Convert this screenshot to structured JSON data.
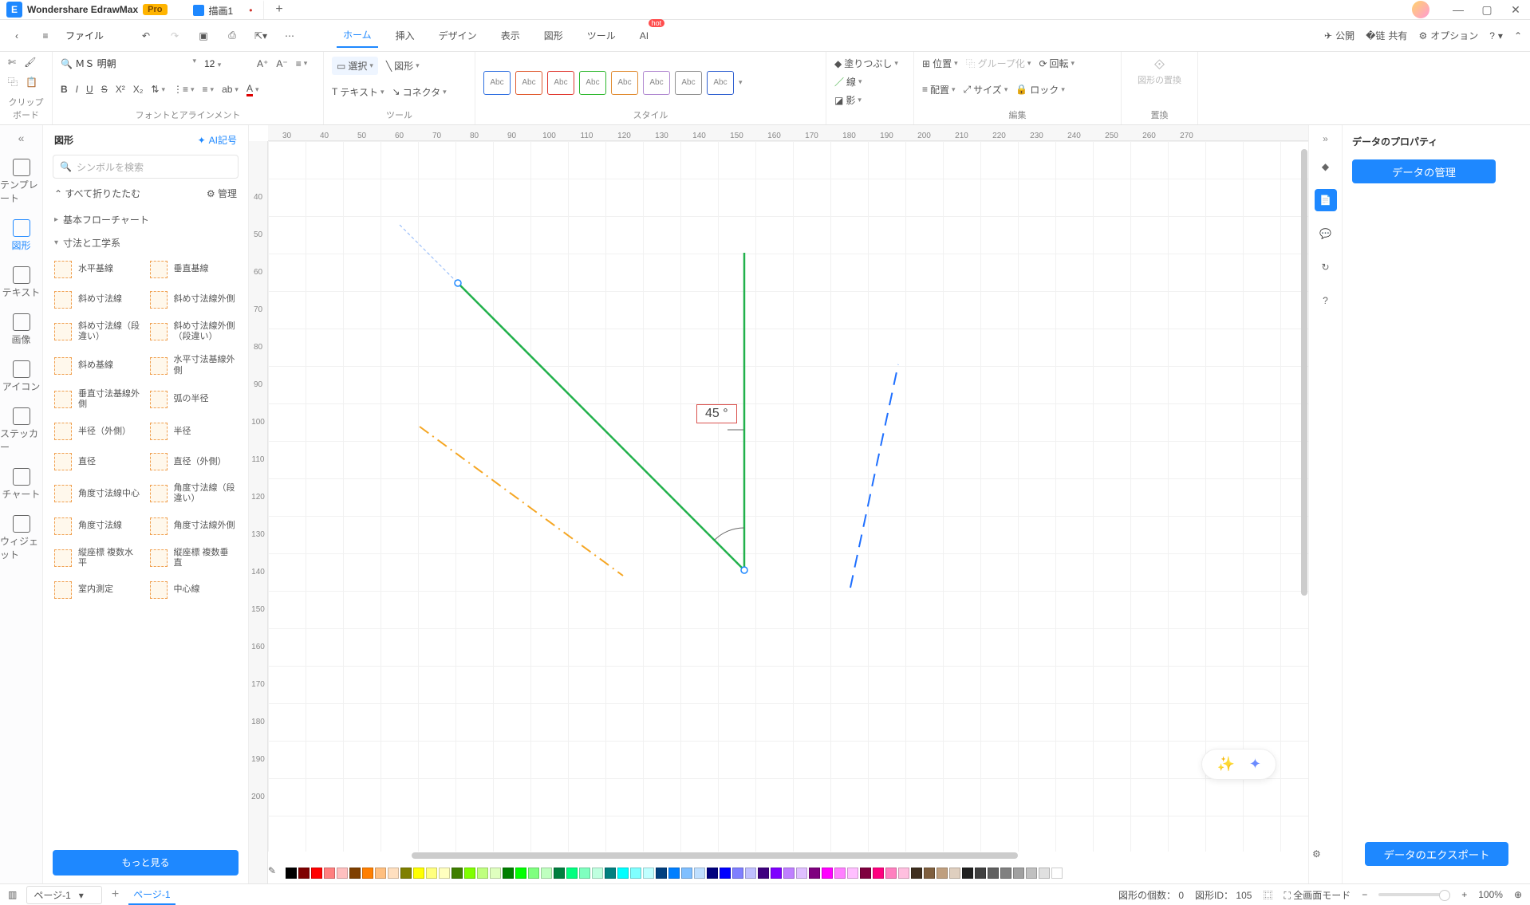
{
  "titlebar": {
    "app_name": "Wondershare EdrawMax",
    "pro": "Pro",
    "tab1": "描画1"
  },
  "menubar": {
    "file": "ファイル",
    "items": [
      "ホーム",
      "挿入",
      "デザイン",
      "表示",
      "図形",
      "ツール",
      "AI"
    ],
    "hot": "hot",
    "publish": "公開",
    "share": "共有",
    "option": "オプション"
  },
  "ribbon": {
    "clipboard_label": "クリップボード",
    "font_label": "フォントとアラインメント",
    "tool_label": "ツール",
    "style_label": "スタイル",
    "edit_label": "編集",
    "replace_label": "置換",
    "font_name": "ＭＳ 明朝",
    "font_size": "12",
    "select": "選択",
    "shape": "図形",
    "text": "テキスト",
    "connector": "コネクタ",
    "fill": "塗りつぶし",
    "line": "線",
    "shadow": "影",
    "position": "位置",
    "group": "グループ化",
    "rotate": "回転",
    "align": "配置",
    "size": "サイズ",
    "lock": "ロック",
    "replace_shape": "図形の置換",
    "abc": "Abc"
  },
  "leftrail": [
    "テンプレート",
    "図形",
    "テキスト",
    "画像",
    "アイコン",
    "ステッカー",
    "チャート",
    "ウィジェット"
  ],
  "shapes": {
    "title": "図形",
    "ai": "AI記号",
    "search_ph": "シンボルを検索",
    "fold_all": "すべて折りたたむ",
    "manage": "管理",
    "cat1": "基本フローチャート",
    "cat2": "寸法と工学系",
    "items": [
      "水平基線",
      "垂直基線",
      "斜め寸法線",
      "斜め寸法線外側",
      "斜め寸法線（段違い）",
      "斜め寸法線外側（段違い）",
      "斜め基線",
      "水平寸法基線外側",
      "垂直寸法基線外側",
      "弧の半径",
      "半径（外側）",
      "半径",
      "直径",
      "直径（外側）",
      "角度寸法線中心",
      "角度寸法線（段違い）",
      "角度寸法線",
      "角度寸法線外側",
      "縦座標 複数水平",
      "縦座標 複数垂直",
      "室内測定",
      "中心線"
    ],
    "more": "もっと見る"
  },
  "ruler_h": [
    "30",
    "40",
    "50",
    "60",
    "70",
    "80",
    "90",
    "100",
    "110",
    "120",
    "130",
    "140",
    "150",
    "160",
    "170",
    "180",
    "190",
    "200",
    "210",
    "220",
    "230",
    "240",
    "250",
    "260",
    "270"
  ],
  "ruler_v": [
    "",
    "40",
    "50",
    "60",
    "70",
    "80",
    "90",
    "100",
    "110",
    "120",
    "130",
    "140",
    "150",
    "160",
    "170",
    "180",
    "190",
    "200"
  ],
  "canvas": {
    "angle_label": "45 °"
  },
  "rightpanel": {
    "title": "データのプロパティ",
    "manage": "データの管理",
    "export": "データのエクスポート"
  },
  "status": {
    "page_sel": "ページ-1",
    "page_tab": "ページ-1",
    "shape_count_lbl": "図形の個数：",
    "shape_count": "0",
    "shape_id_lbl": "図形ID：",
    "shape_id": "105",
    "fullscreen": "全画面モード",
    "zoom": "100%"
  },
  "palette": [
    "#000000",
    "#7f0000",
    "#ff0000",
    "#ff7f7f",
    "#ffbfbf",
    "#7f3f00",
    "#ff7f00",
    "#ffbf7f",
    "#ffdfbf",
    "#7f7f00",
    "#ffff00",
    "#ffff7f",
    "#ffffbf",
    "#3f7f00",
    "#7fff00",
    "#bfff7f",
    "#dfffbf",
    "#007f00",
    "#00ff00",
    "#7fff7f",
    "#bfffbf",
    "#007f3f",
    "#00ff7f",
    "#7fffbf",
    "#bfffdf",
    "#007f7f",
    "#00ffff",
    "#7fffff",
    "#bfffff",
    "#003f7f",
    "#007fff",
    "#7fbfff",
    "#bfdfff",
    "#00007f",
    "#0000ff",
    "#7f7fff",
    "#bfbfff",
    "#3f007f",
    "#7f00ff",
    "#bf7fff",
    "#dfbfff",
    "#7f007f",
    "#ff00ff",
    "#ff7fff",
    "#ffbfff",
    "#7f003f",
    "#ff007f",
    "#ff7fbf",
    "#ffbfdf",
    "#3f2f1f",
    "#7f5f3f",
    "#bf9f7f",
    "#dfcfbf",
    "#202020",
    "#404040",
    "#606060",
    "#808080",
    "#a0a0a0",
    "#c0c0c0",
    "#e0e0e0",
    "#ffffff"
  ]
}
